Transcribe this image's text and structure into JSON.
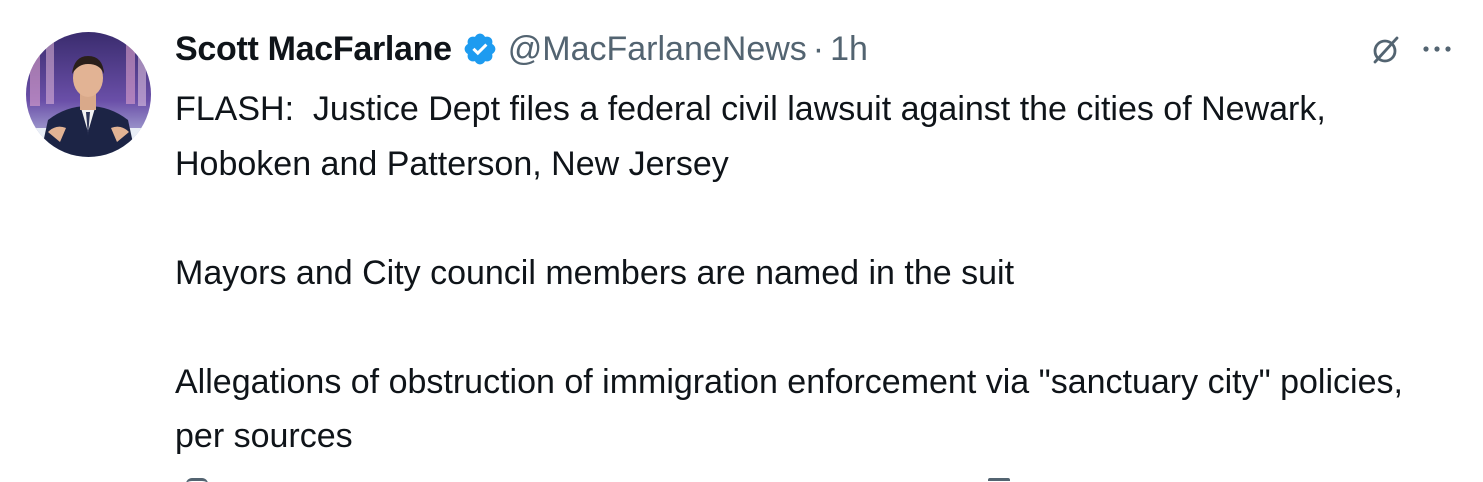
{
  "tweet": {
    "author": {
      "display_name": "Scott MacFarlane",
      "handle": "@MacFarlaneNews",
      "verified": true,
      "avatar_icon": "profile-photo-icon"
    },
    "separator": "·",
    "timestamp": "1h",
    "paragraphs": [
      "FLASH:  Justice Dept files a federal civil lawsuit against the cities of Newark, Hoboken and Patterson, New Jersey",
      "Mayors and City council members are named in the suit",
      "Allegations of obstruction of immigration enforcement via \"sanctuary city\" policies, per sources"
    ]
  },
  "icons": {
    "verified": "verified-badge-icon",
    "grok": "grok-icon",
    "more": "more-options-icon"
  },
  "colors": {
    "text_primary": "#0f1419",
    "text_secondary": "#536471",
    "verified_blue": "#1d9bf0",
    "background": "#ffffff"
  }
}
